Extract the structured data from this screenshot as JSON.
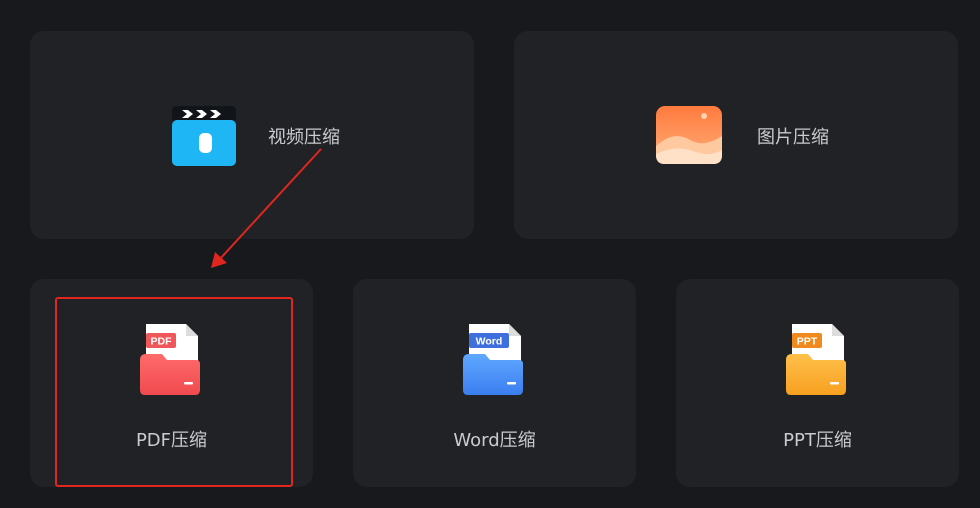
{
  "cards": {
    "video": {
      "label": "视频压缩",
      "icon": "video-clapper-icon"
    },
    "image": {
      "label": "图片压缩",
      "icon": "image-icon"
    },
    "pdf": {
      "label": "PDF压缩",
      "badge": "PDF",
      "icon": "pdf-file-icon",
      "color": "#f0575a"
    },
    "word": {
      "label": "Word压缩",
      "badge": "Word",
      "icon": "word-file-icon",
      "color": "#3f7df0"
    },
    "ppt": {
      "label": "PPT压缩",
      "badge": "PPT",
      "icon": "ppt-file-icon",
      "color": "#f7a22b"
    }
  },
  "annotation": {
    "highlight_color": "#e0261e"
  }
}
